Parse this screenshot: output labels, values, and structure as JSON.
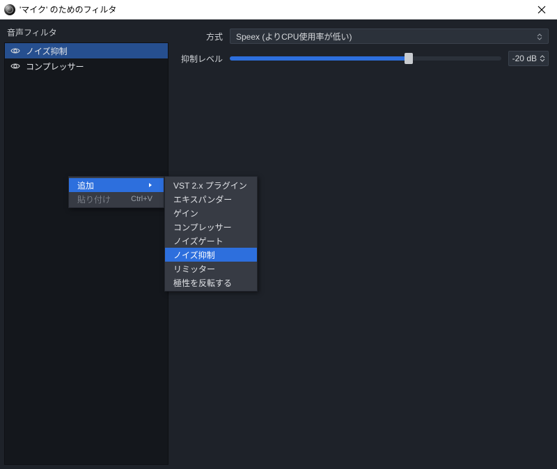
{
  "titlebar": {
    "title": "'マイク' のためのフィルタ"
  },
  "left_panel": {
    "header": "音声フィルタ",
    "filters": [
      {
        "label": "ノイズ抑制",
        "selected": true
      },
      {
        "label": "コンプレッサー",
        "selected": false
      }
    ]
  },
  "properties": {
    "method": {
      "label": "方式",
      "value": "Speex (よりCPU使用率が低い)"
    },
    "suppress": {
      "label": "抑制レベル",
      "value_text": "-20 dB",
      "fill_percent": 66
    }
  },
  "context_menu": {
    "items": [
      {
        "label": "追加",
        "submenu": true,
        "highlight": true
      },
      {
        "label": "貼り付け",
        "shortcut": "Ctrl+V",
        "disabled": true
      }
    ]
  },
  "submenu": {
    "items": [
      {
        "label": "VST 2.x プラグイン"
      },
      {
        "label": "エキスパンダー"
      },
      {
        "label": "ゲイン"
      },
      {
        "label": "コンプレッサー"
      },
      {
        "label": "ノイズゲート"
      },
      {
        "label": "ノイズ抑制",
        "highlight": true
      },
      {
        "label": "リミッター"
      },
      {
        "label": "極性を反転する"
      }
    ]
  }
}
